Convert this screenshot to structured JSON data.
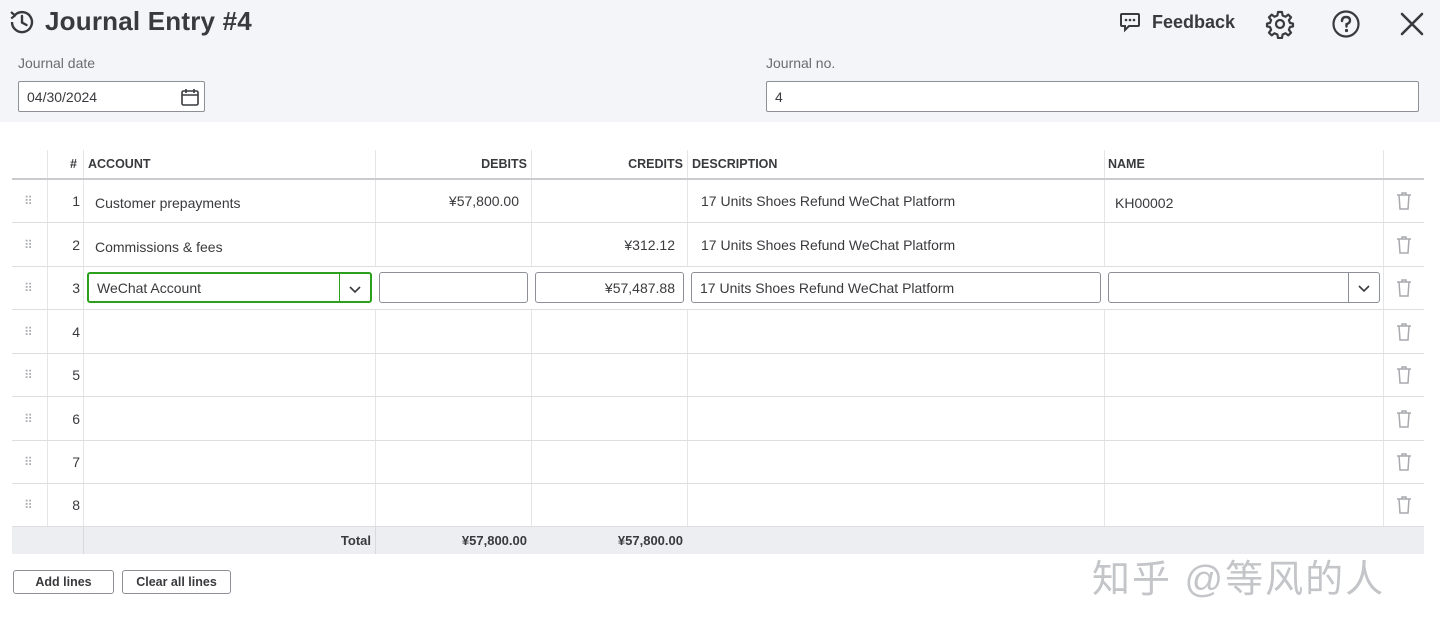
{
  "header": {
    "title": "Journal Entry #4",
    "feedback_label": "Feedback",
    "journal_date_label": "Journal date",
    "journal_date_value": "04/30/2024",
    "journal_no_label": "Journal no.",
    "journal_no_value": "4"
  },
  "table": {
    "columns": {
      "num": "#",
      "account": "ACCOUNT",
      "debits": "DEBITS",
      "credits": "CREDITS",
      "description": "DESCRIPTION",
      "name": "NAME"
    },
    "rows": [
      {
        "num": "1",
        "account": "Customer prepayments",
        "debits": "¥57,800.00",
        "credits": "",
        "description": "17 Units Shoes Refund WeChat Platform",
        "name": "KH00002"
      },
      {
        "num": "2",
        "account": "Commissions & fees",
        "debits": "",
        "credits": "¥312.12",
        "description": "17 Units Shoes Refund WeChat Platform",
        "name": ""
      },
      {
        "num": "3",
        "account": "WeChat Account",
        "debits": "",
        "credits": "¥57,487.88",
        "description": "17 Units Shoes Refund WeChat Platform",
        "name": ""
      },
      {
        "num": "4"
      },
      {
        "num": "5"
      },
      {
        "num": "6"
      },
      {
        "num": "7"
      },
      {
        "num": "8"
      }
    ],
    "total": {
      "label": "Total",
      "debits": "¥57,800.00",
      "credits": "¥57,800.00"
    }
  },
  "buttons": {
    "add_lines": "Add lines",
    "clear_all_lines": "Clear all lines"
  },
  "watermark": "知乎 @等风的人",
  "colors": {
    "accent_green": "#2ca01c",
    "header_bg": "#f4f5f8",
    "total_bg": "#eceef1"
  }
}
